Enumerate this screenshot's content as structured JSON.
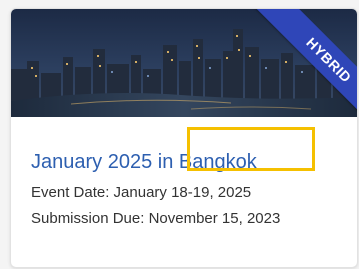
{
  "card": {
    "ribbon_label": "HYBRID",
    "title_month_prefix": "January 2025 in ",
    "title_city": "Bangkok",
    "event_date_label": "Event Date: ",
    "event_date_value": "January 18-19, 2025",
    "submission_due_label": "Submission Due: ",
    "submission_due_value": "November 15, 2023",
    "image_alt": "Bangkok skyline at night"
  },
  "colors": {
    "ribbon": "#2f46b8",
    "title_link": "#2d5fb0",
    "highlight": "#f5c000",
    "body_text": "#333333"
  }
}
